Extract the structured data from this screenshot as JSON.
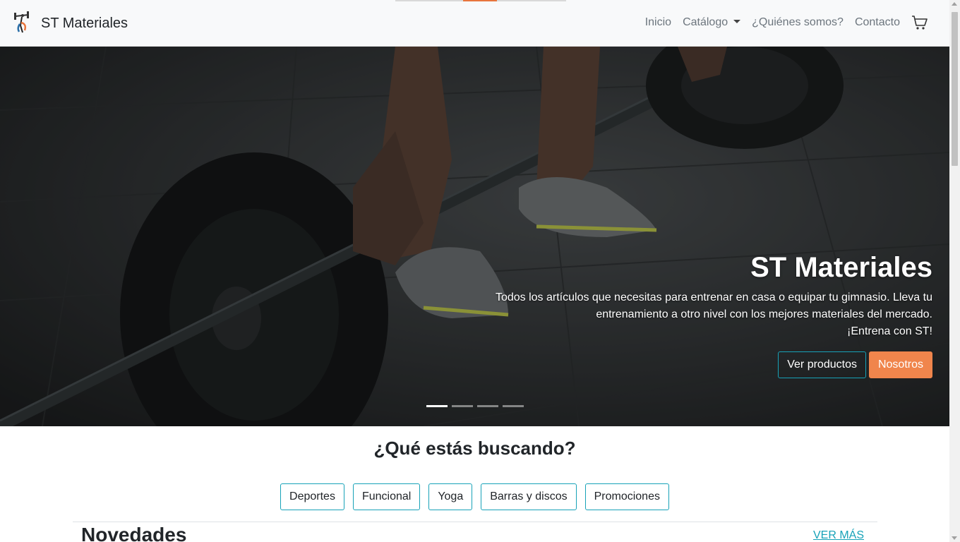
{
  "navbar": {
    "brand_name": "ST Materiales",
    "logo_icon": "barbell-logo-icon",
    "links": [
      {
        "label": "Inicio"
      },
      {
        "label": "Catálogo"
      },
      {
        "label": "¿Quiénes somos?"
      },
      {
        "label": "Contacto"
      }
    ],
    "cart_icon": "shopping-cart-icon"
  },
  "hero": {
    "title": "ST Materiales",
    "text_line1": "Todos los artículos que necesitas para entrenar en casa o equipar tu gimnasio. Lleva tu",
    "text_line2": "entrenamiento a otro nivel con los mejores materiales del mercado.",
    "text_line3": "¡Entrena con ST!",
    "btn_products": "Ver productos",
    "btn_about": "Nosotros",
    "slides": 4,
    "active_slide": 1
  },
  "search": {
    "title": "¿Qué estás buscando?",
    "categories": [
      {
        "label": "Deportes"
      },
      {
        "label": "Funcional"
      },
      {
        "label": "Yoga"
      },
      {
        "label": "Barras y discos"
      },
      {
        "label": "Promociones"
      }
    ]
  },
  "news": {
    "title": "Novedades",
    "see_more": "VER MÁS"
  },
  "colors": {
    "accent_teal": "#17a2b8",
    "accent_orange": "#f0854c",
    "navbar_bg": "#f8f9fa"
  }
}
